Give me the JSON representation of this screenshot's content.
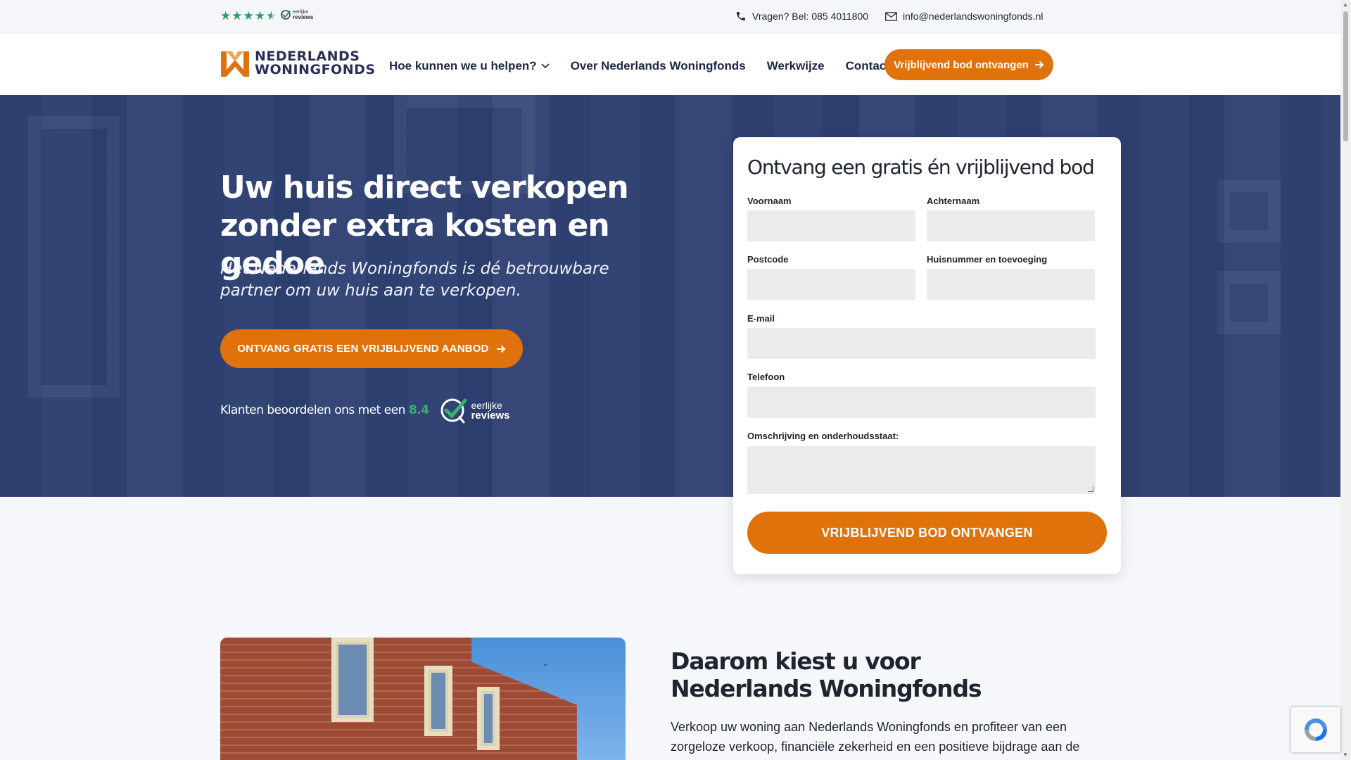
{
  "topbar": {
    "rating_stars": 4.5,
    "reviews_brand_line1": "eerlijke",
    "reviews_brand_line2": "reviews",
    "phone_text": "Vragen? Bel: 085 4011800",
    "email_text": "info@nederlandswoningfonds.nl"
  },
  "header": {
    "logo_line1": "NEDERLANDS",
    "logo_line2": "WONINGFONDS",
    "nav": [
      {
        "label": "Hoe kunnen we u helpen?"
      },
      {
        "label": "Over Nederlands Woningfonds"
      },
      {
        "label": "Werkwijze"
      },
      {
        "label": "Contact"
      }
    ],
    "cta_label": "Vrijblijvend bod ontvangen"
  },
  "hero": {
    "title": "Uw huis direct verkopen zonder extra kosten en gedoe",
    "subtitle": "Het Nederlands Woningfonds is dé betrouwbare partner om uw huis aan te verkopen.",
    "cta_label": "ONTVANG GRATIS EEN VRIJBLIJVEND AANBOD",
    "rating_text": "Klanten beoordelen ons met een",
    "rating_score": "8.4",
    "reviews_line1": "eerlijke",
    "reviews_line2": "reviews"
  },
  "form": {
    "title": "Ontvang een gratis én vrijblijvend bod",
    "fields": {
      "voornaam": {
        "label": "Voornaam",
        "value": ""
      },
      "achternaam": {
        "label": "Achternaam",
        "value": ""
      },
      "postcode": {
        "label": "Postcode",
        "value": ""
      },
      "huisnummer": {
        "label": "Huisnummer en toevoeging",
        "value": ""
      },
      "email": {
        "label": "E-mail",
        "value": ""
      },
      "telefoon": {
        "label": "Telefoon",
        "value": ""
      },
      "omschrijving": {
        "label": "Omschrijving en onderhoudsstaat:",
        "value": ""
      }
    },
    "submit_label": "VRIJBLIJVEND BOD ONTVANGEN"
  },
  "section": {
    "title": "Daarom kiest u voor Nederlands Woningfonds",
    "text": "Verkoop uw woning aan Nederlands Woningfonds en profiteer van een zorgeloze verkoop, financiële zekerheid en een positieve bijdrage aan de"
  },
  "colors": {
    "accent": "#e0720c",
    "brand_navy": "#2b2f56",
    "rating_green": "#2f9a62",
    "hero_overlay": "#2c3e70"
  },
  "icons": {
    "phone": "phone-icon",
    "mail": "mail-icon",
    "arrow": "arrow-right-icon",
    "chevron": "chevron-down-icon",
    "reviews": "check-badge-icon",
    "captcha": "recaptcha-icon"
  }
}
